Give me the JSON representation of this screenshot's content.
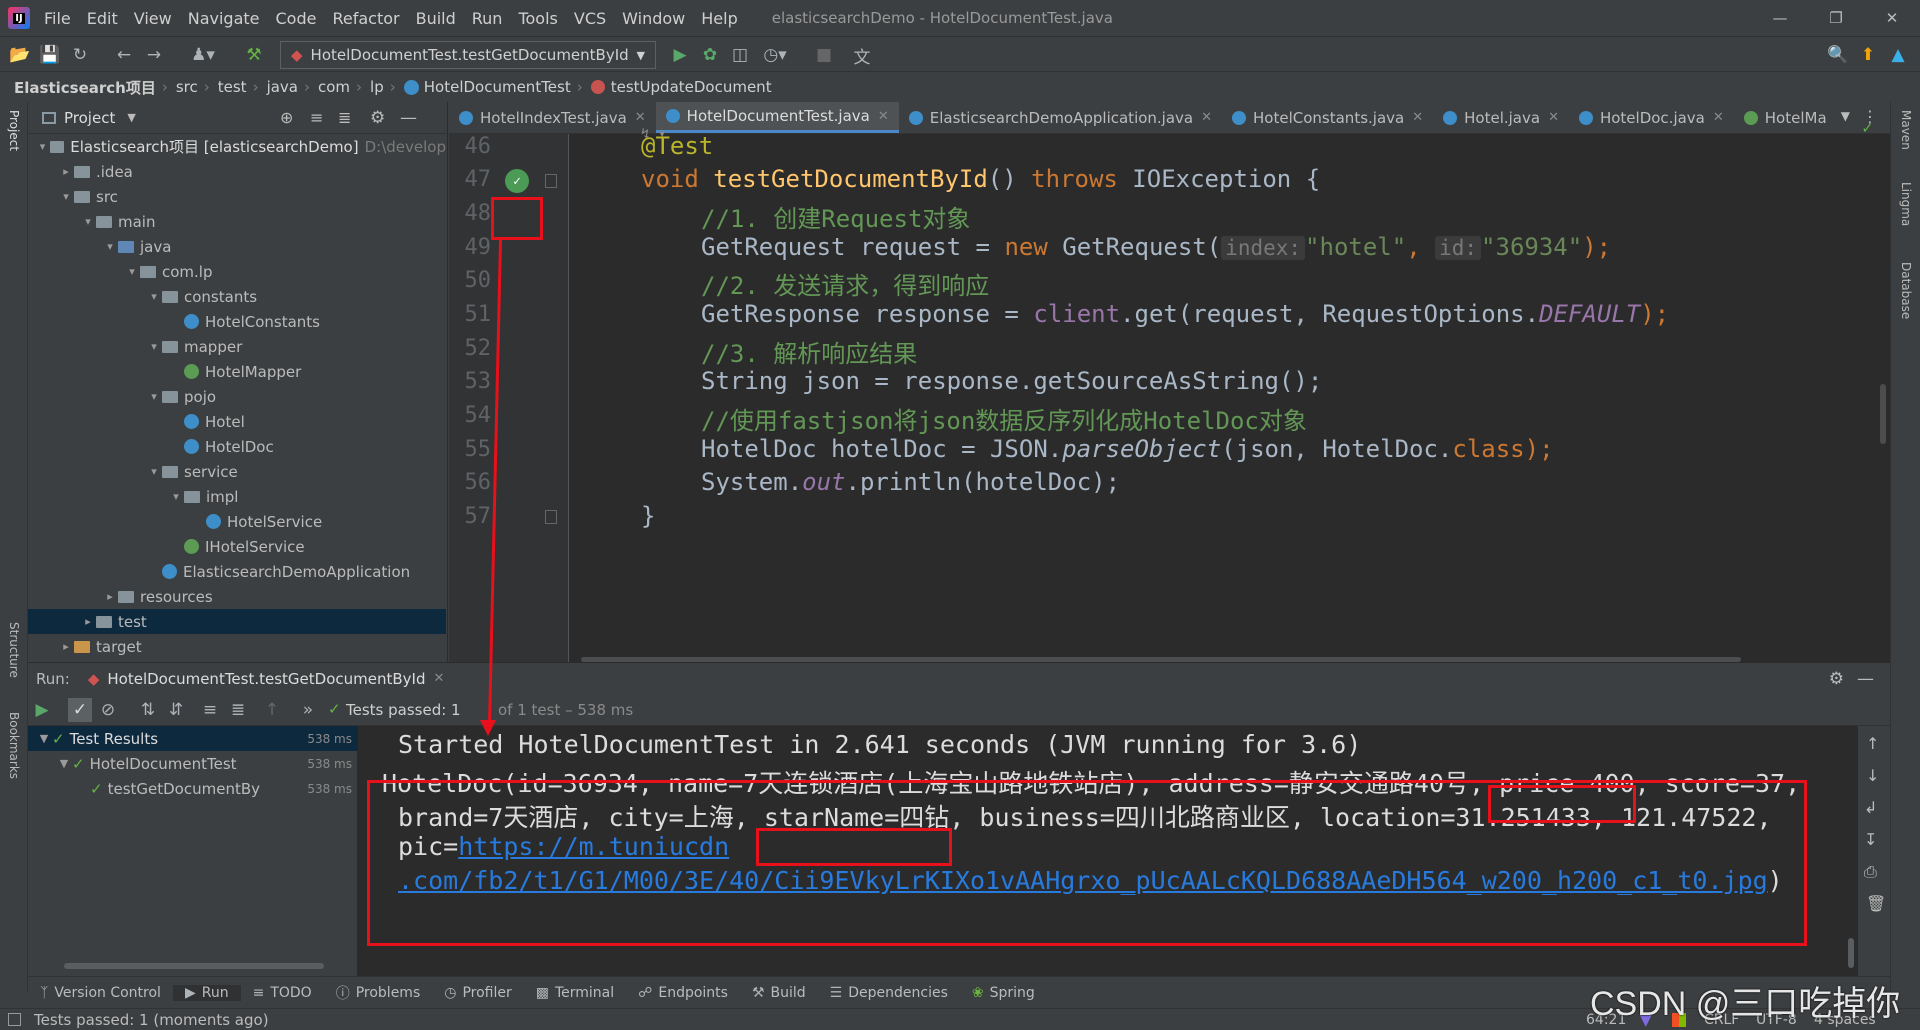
{
  "menubar": {
    "items": [
      "File",
      "Edit",
      "View",
      "Navigate",
      "Code",
      "Refactor",
      "Build",
      "Run",
      "Tools",
      "VCS",
      "Window",
      "Help"
    ],
    "title": "elasticsearchDemo - HotelDocumentTest.java"
  },
  "toolbar": {
    "run_config": "HotelDocumentTest.testGetDocumentById"
  },
  "breadcrumb": [
    "Elasticsearch项目",
    "src",
    "test",
    "java",
    "com",
    "lp",
    "HotelDocumentTest",
    "testUpdateDocument"
  ],
  "project": {
    "header": "Project",
    "tree": [
      {
        "label": "Elasticsearch项目 [elasticsearchDemo]",
        "suffix": "D:\\develop",
        "level": 0,
        "kind": "folder",
        "open": true
      },
      {
        "label": ".idea",
        "level": 1,
        "kind": "folder",
        "open": false
      },
      {
        "label": "src",
        "level": 1,
        "kind": "folder",
        "open": true
      },
      {
        "label": "main",
        "level": 2,
        "kind": "folder",
        "open": true
      },
      {
        "label": "java",
        "level": 3,
        "kind": "folder-blue",
        "open": true
      },
      {
        "label": "com.lp",
        "level": 4,
        "kind": "folder",
        "open": true
      },
      {
        "label": "constants",
        "level": 5,
        "kind": "folder",
        "open": true
      },
      {
        "label": "HotelConstants",
        "level": 6,
        "kind": "class"
      },
      {
        "label": "mapper",
        "level": 5,
        "kind": "folder",
        "open": true
      },
      {
        "label": "HotelMapper",
        "level": 6,
        "kind": "interface"
      },
      {
        "label": "pojo",
        "level": 5,
        "kind": "folder",
        "open": true
      },
      {
        "label": "Hotel",
        "level": 6,
        "kind": "class"
      },
      {
        "label": "HotelDoc",
        "level": 6,
        "kind": "class"
      },
      {
        "label": "service",
        "level": 5,
        "kind": "folder",
        "open": true
      },
      {
        "label": "impl",
        "level": 6,
        "kind": "folder",
        "open": true
      },
      {
        "label": "HotelService",
        "level": 7,
        "kind": "class"
      },
      {
        "label": "IHotelService",
        "level": 6,
        "kind": "interface"
      },
      {
        "label": "ElasticsearchDemoApplication",
        "level": 5,
        "kind": "class"
      },
      {
        "label": "resources",
        "level": 3,
        "kind": "folder",
        "open": false
      },
      {
        "label": "test",
        "level": 2,
        "kind": "folder",
        "open": false,
        "selected": true
      },
      {
        "label": "target",
        "level": 1,
        "kind": "folder-orange",
        "open": false
      }
    ]
  },
  "tabs": [
    {
      "label": "HotelIndexTest.java",
      "active": false
    },
    {
      "label": "HotelDocumentTest.java",
      "active": true
    },
    {
      "label": "ElasticsearchDemoApplication.java",
      "active": false
    },
    {
      "label": "HotelConstants.java",
      "active": false
    },
    {
      "label": "Hotel.java",
      "active": false
    },
    {
      "label": "HotelDoc.java",
      "active": false
    },
    {
      "label": "HotelMa",
      "active": false
    }
  ],
  "editor": {
    "line_numbers": [
      "46",
      "47",
      "48",
      "49",
      "50",
      "51",
      "52",
      "53",
      "54",
      "55",
      "56",
      "57"
    ],
    "annotation": "@Test",
    "l47_void": "void ",
    "l47_name": "testGetDocumentById",
    "l47_rest": "() ",
    "l47_throws": "throws",
    "l47_exc": " IOException {",
    "l48": "//1. 创建Request对象",
    "l49_a": "GetRequest request = ",
    "l49_new": "new",
    "l49_b": " GetRequest(",
    "l49_hint1": "index:",
    "l49_s1": "\"hotel\"",
    "l49_comma": ", ",
    "l49_hint2": "id:",
    "l49_s2": "\"36934\"",
    "l49_end": ");",
    "l50": "//2. 发送请求，得到响应",
    "l51_a": "GetResponse response = ",
    "l51_client": "client",
    "l51_b": ".get(request, RequestOptions.",
    "l51_default": "DEFAULT",
    "l51_end": ");",
    "l52": "//3. 解析响应结果",
    "l53": "String json = response.getSourceAsString();",
    "l54": "//使用fastjson将json数据反序列化成HotelDoc对象",
    "l55_a": "HotelDoc hotelDoc = JSON.",
    "l55_parse": "parseObject",
    "l55_b": "(json, HotelDoc.",
    "l55_class": "class",
    "l55_end": ");",
    "l56_a": "System.",
    "l56_out": "out",
    "l56_b": ".println(hotelDoc);",
    "l57": "}"
  },
  "run": {
    "label": "Run:",
    "tab": "HotelDocumentTest.testGetDocumentById",
    "passed_status": "Tests passed: 1",
    "passed_detail": "of 1 test – 538 ms"
  },
  "test_tree": [
    {
      "label": "Test Results",
      "time": "538 ms",
      "level": 0
    },
    {
      "label": "HotelDocumentTest",
      "time": "538 ms",
      "level": 1
    },
    {
      "label": "testGetDocumentBy",
      "time": "538 ms",
      "level": 2
    }
  ],
  "console": {
    "line1": "Started HotelDocumentTest in 2.641 seconds (JVM running for 3.6)",
    "line2_a": "HotelDoc(id=36934, name=7天连锁酒店(上海宝山路地铁站店), address=静安交通路40号, ",
    "line2_price": "price=400",
    "line2_b": ", score=37,",
    "line3_a": "brand=7天酒店, city=上海, ",
    "line3_star": "starName=四钻",
    "line3_b": ", business=四川北路商业区, location=31.251433, 121.47522,",
    "line4_a": "pic=",
    "line4_link": "https://m.tuniucdn",
    "line5_link": ".com/fb2/t1/G1/M00/3E/40/Cii9EVkyLrKIXo1vAAHgrxo_pUcAALcKQLD688AAeDH564_w200_h200_c1_t0.jpg",
    "line5_end": ")"
  },
  "bottom_tabs": [
    "Version Control",
    "Run",
    "TODO",
    "Problems",
    "Profiler",
    "Terminal",
    "Endpoints",
    "Build",
    "Dependencies",
    "Spring"
  ],
  "left_stripe": [
    "Project",
    "Structure",
    "Bookmarks"
  ],
  "right_stripe": [
    "Maven",
    "Lingma",
    "Database"
  ],
  "status": {
    "message": "Tests passed: 1 (moments ago)",
    "position": "64:21",
    "line_sep": "CRLF",
    "encoding": "UTF-8",
    "indent": "4 spaces"
  },
  "watermark": "CSDN @三口吃掉你",
  "colors": {
    "highlight_box": "#e8101b",
    "pass_green": "#62b543",
    "link": "#287bde"
  }
}
